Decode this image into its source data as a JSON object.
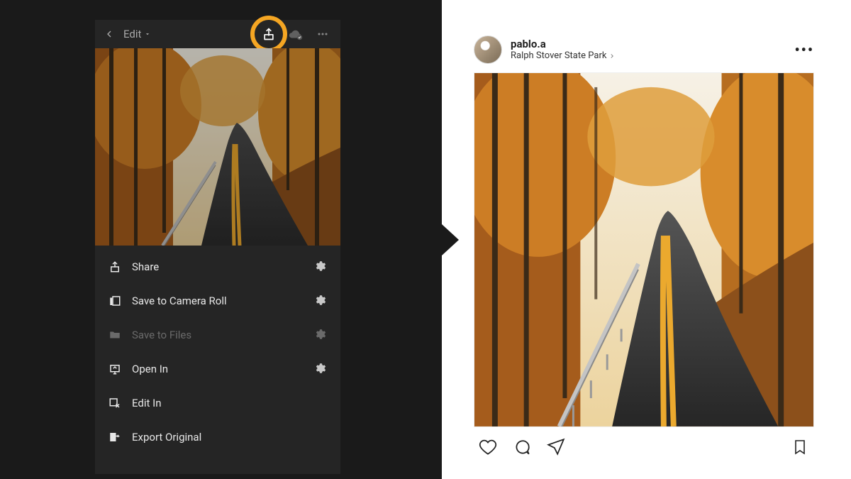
{
  "app": {
    "toolbar": {
      "title": "Edit"
    },
    "menu": [
      {
        "label": "Share",
        "gear": true,
        "disabled": false,
        "icon": "share"
      },
      {
        "label": "Save to Camera Roll",
        "gear": true,
        "disabled": false,
        "icon": "camera-roll"
      },
      {
        "label": "Save to Files",
        "gear": true,
        "disabled": true,
        "icon": "folder"
      },
      {
        "label": "Open In",
        "gear": true,
        "disabled": false,
        "icon": "open-in"
      },
      {
        "label": "Edit In",
        "gear": false,
        "disabled": false,
        "icon": "edit-in"
      },
      {
        "label": "Export Original",
        "gear": false,
        "disabled": false,
        "icon": "export"
      }
    ]
  },
  "instagram": {
    "username": "pablo.a",
    "location": "Ralph Stover State Park"
  }
}
